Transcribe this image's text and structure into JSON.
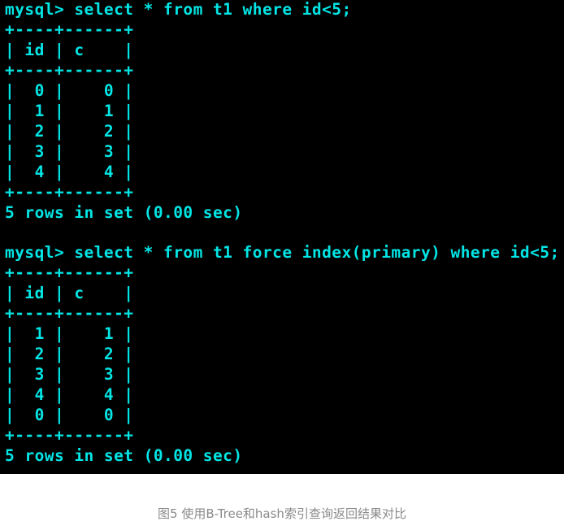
{
  "terminal": {
    "lines": [
      "mysql> select * from t1 where id<5;",
      "+----+------+",
      "| id | c    |",
      "+----+------+",
      "|  0 |    0 |",
      "|  1 |    1 |",
      "|  2 |    2 |",
      "|  3 |    3 |",
      "|  4 |    4 |",
      "+----+------+",
      "5 rows in set (0.00 sec)",
      "",
      "mysql> select * from t1 force index(primary) where id<5;",
      "+----+------+",
      "| id | c    |",
      "+----+------+",
      "|  1 |    1 |",
      "|  2 |    2 |",
      "|  3 |    3 |",
      "|  4 |    4 |",
      "|  0 |    0 |",
      "+----+------+",
      "5 rows in set (0.00 sec)"
    ]
  },
  "caption": "图5 使用B-Tree和hash索引查询返回结果对比"
}
